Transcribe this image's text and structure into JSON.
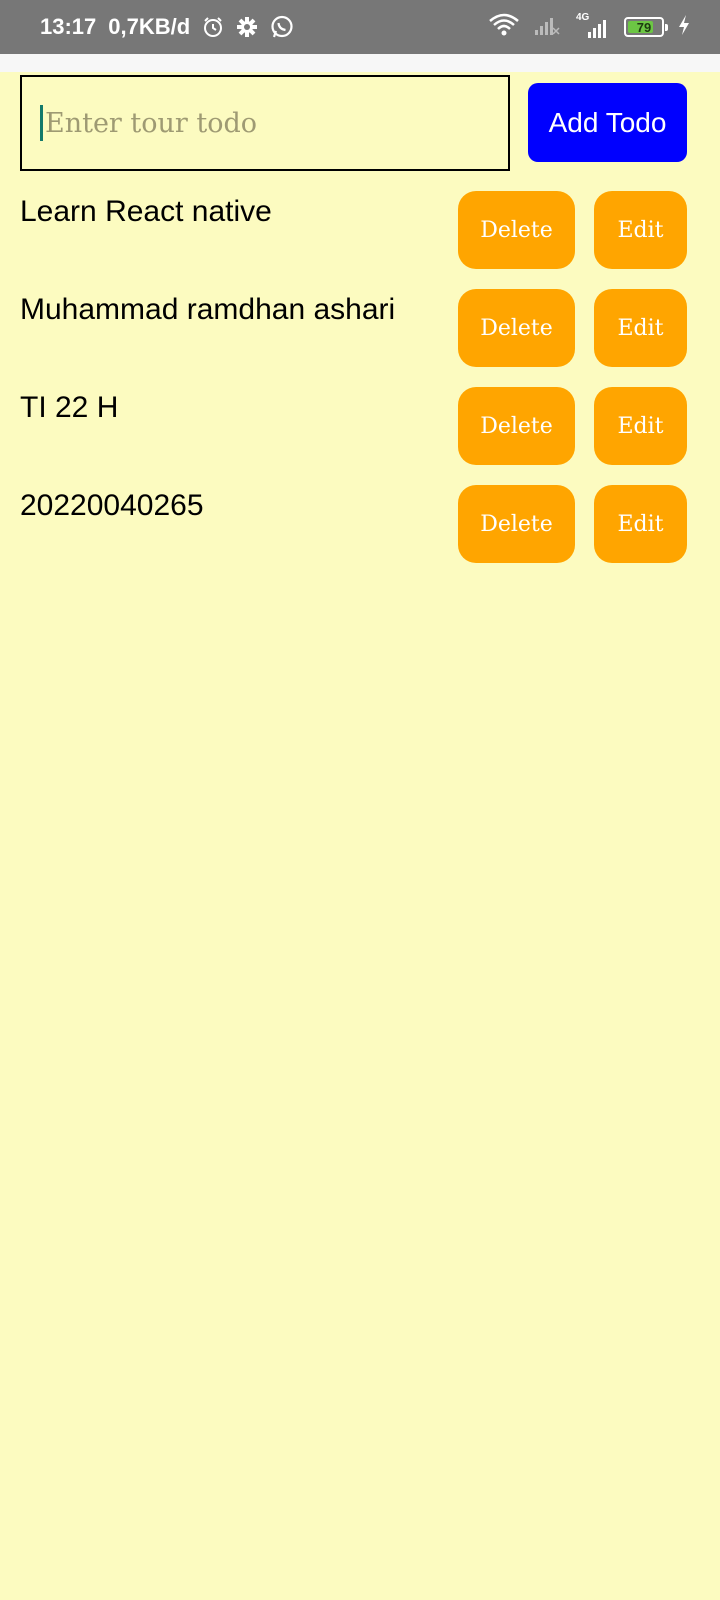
{
  "status_bar": {
    "time": "13:17",
    "net_speed": "0,7KB/d",
    "alarm_icon": "alarm-icon",
    "settings_icon": "gear-icon",
    "whatsapp_icon": "whatsapp-icon",
    "wifi_icon": "wifi-icon",
    "signal_icon": "signal-icon",
    "network_type": "4G",
    "battery_level": "79",
    "battery_fraction": 0.79,
    "charging_icon": "bolt-icon"
  },
  "input": {
    "placeholder": "Enter tour todo",
    "value": ""
  },
  "add_button": {
    "label": "Add Todo"
  },
  "todos": [
    {
      "text": "Learn React native",
      "delete_label": "Delete",
      "edit_label": "Edit"
    },
    {
      "text": "Muhammad ramdhan ashari",
      "delete_label": "Delete",
      "edit_label": "Edit"
    },
    {
      "text": "TI 22 H",
      "delete_label": "Delete",
      "edit_label": "Edit"
    },
    {
      "text": "20220040265",
      "delete_label": "Delete",
      "edit_label": "Edit"
    }
  ],
  "colors": {
    "background": "#fcfbc0",
    "add_button": "#0000ff",
    "action_button": "#ffa500",
    "status_bar": "#777777"
  }
}
